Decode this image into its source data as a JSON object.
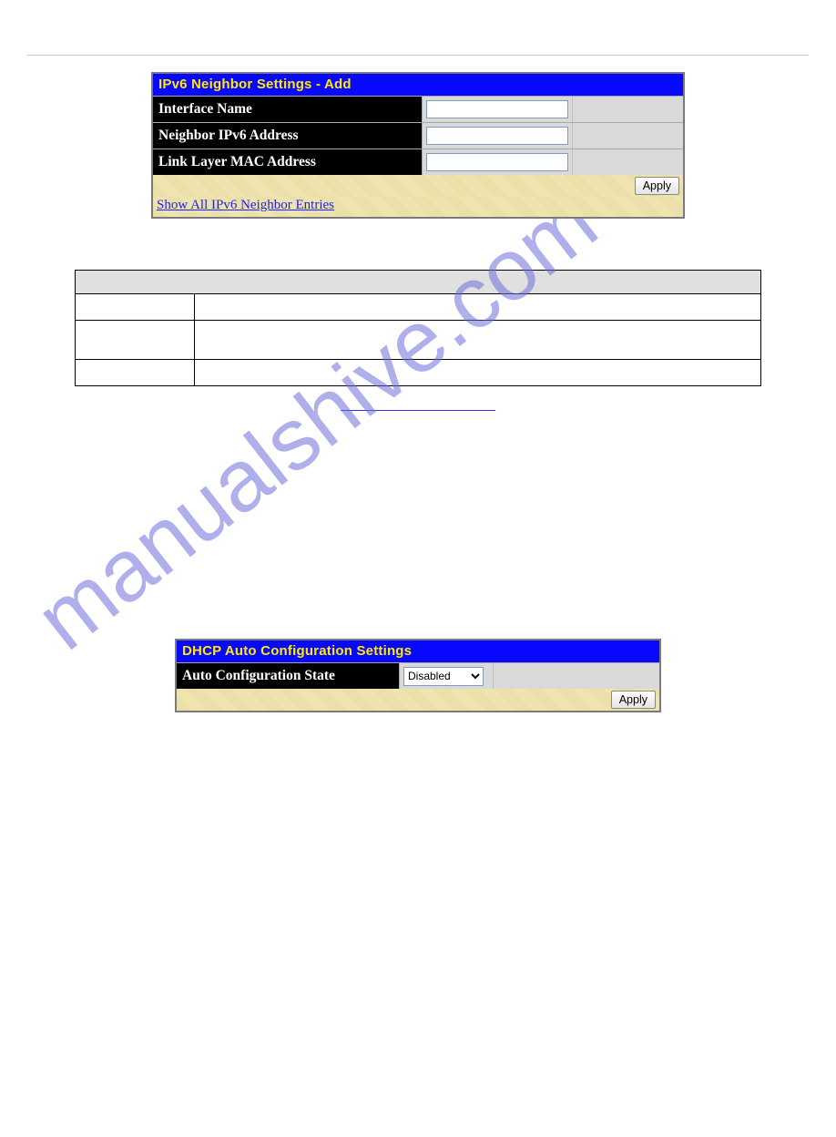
{
  "panel1": {
    "title": "IPv6 Neighbor Settings - Add",
    "rows": [
      {
        "label": "Interface Name",
        "value": ""
      },
      {
        "label": "Neighbor IPv6 Address",
        "value": ""
      },
      {
        "label": "Link Layer MAC Address",
        "value": ""
      }
    ],
    "apply": "Apply",
    "link": "Show All IPv6 Neighbor Entries"
  },
  "panel2": {
    "title": "DHCP Auto Configuration Settings",
    "row": {
      "label": "Auto Configuration State",
      "selected": "Disabled"
    },
    "apply": "Apply"
  },
  "watermark": "manualshive.com"
}
